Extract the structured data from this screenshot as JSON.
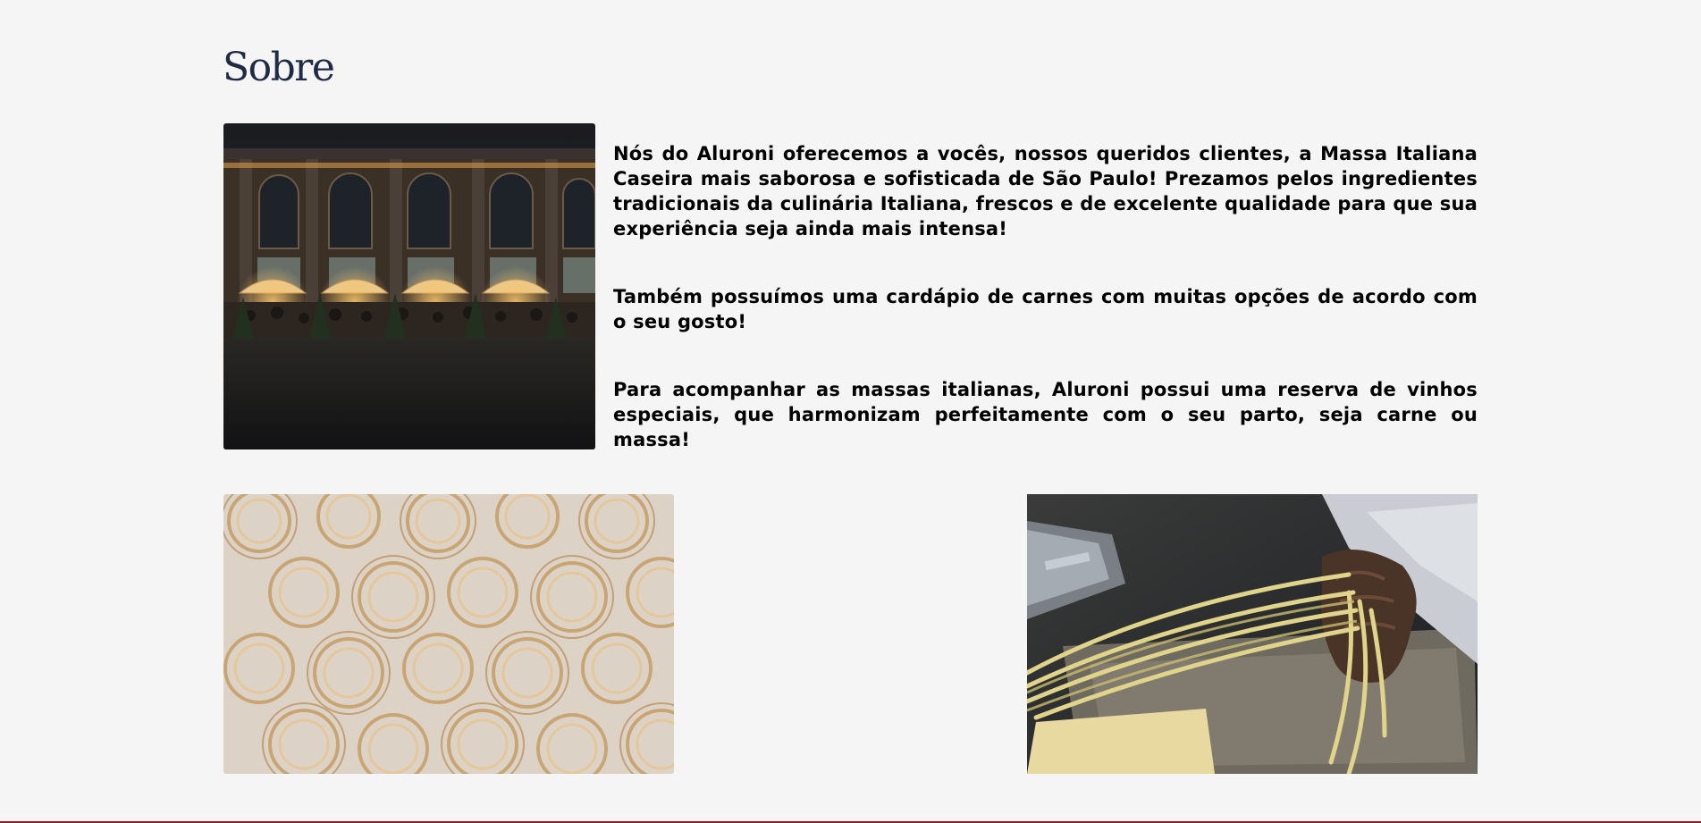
{
  "about": {
    "title": "Sobre",
    "paragraphs": [
      "Nós do Aluroni oferecemos a vocês, nossos queridos clientes, a Massa Italiana Caseira mais saborosa e sofisticada de São Paulo! Prezamos pelos ingredientes tradicionais da culinária Italiana, frescos e de excelente qualidade para que sua experiência seja ainda mais intensa!",
      "Também possuímos uma cardápio de carnes com muitas opções de acordo com o seu gosto!",
      "Para acompanhar as massas italianas, Aluroni possui uma reserva de vinhos especiais, que harmonizam perfeitamente com o seu parto, seja carne ou massa!"
    ]
  },
  "images": [
    {
      "name": "restaurant-terrace-photo"
    },
    {
      "name": "pasta-nests-photo"
    },
    {
      "name": "fresh-pasta-hands-photo"
    }
  ],
  "colors": {
    "background": "#f5f5f5",
    "title": "#1f2a44",
    "footer_line": "#8a1c2b"
  }
}
